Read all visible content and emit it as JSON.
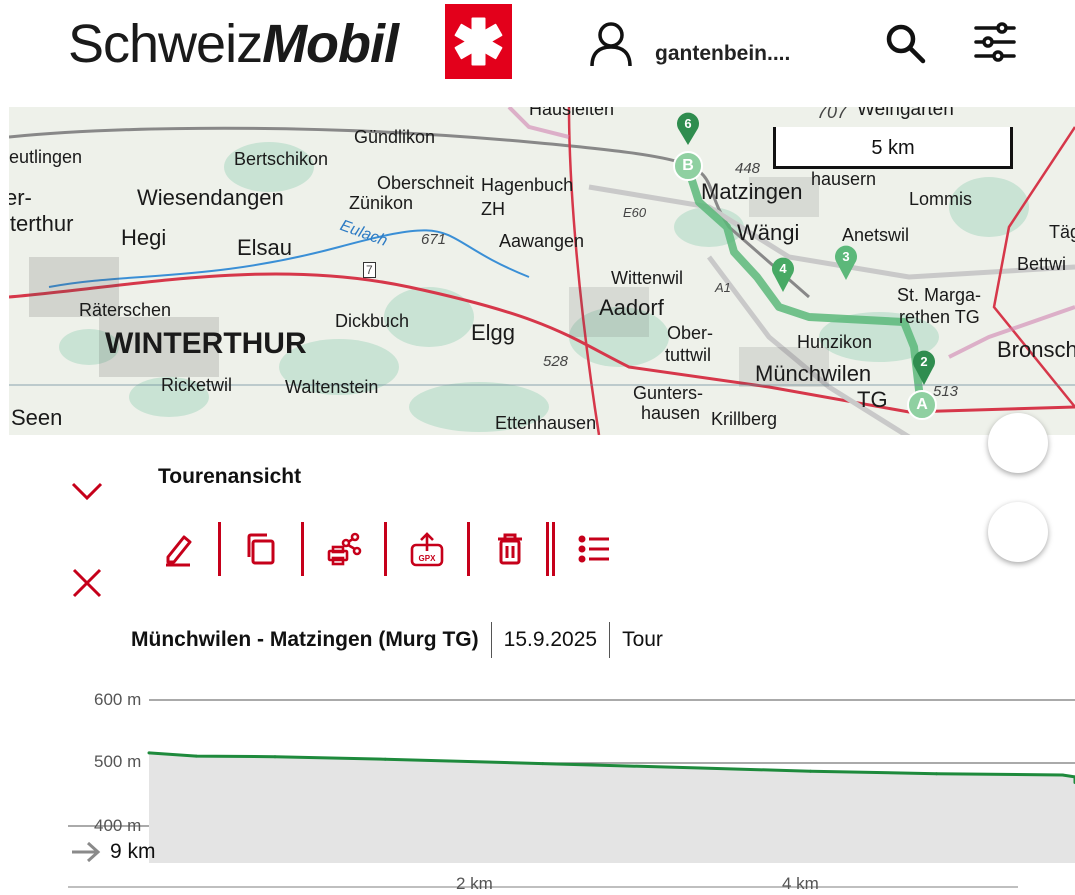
{
  "header": {
    "logo_light": "Schweiz",
    "logo_bold": "Mobil",
    "username": "gantenbein....",
    "icons": [
      "user-icon",
      "search-icon",
      "filter-icon"
    ]
  },
  "map": {
    "scale_label": "5 km",
    "places": [
      "Hausleiten",
      "Weingarten",
      "707",
      "eutlingen",
      "Gündlikon",
      "Bertschikon",
      "448",
      "Matzingen",
      "hausern",
      "Lommis",
      "er-",
      "Wiesendangen",
      "Oberschneit",
      "Hagenbuch",
      "Zünikon",
      "ZH",
      "E60",
      "Wängi",
      "Anetswil",
      "Täg",
      "iterthur",
      "Hegi",
      "Elsau",
      "Eulach",
      "671",
      "Aawangen",
      "Bettwi",
      "Wittenwil",
      "A1",
      "St. Marga-",
      "rethen TG",
      "Räterschen",
      "Dickbuch",
      "Aadorf",
      "Ober-",
      "tuttwil",
      "Hunzikon",
      "Bronsch",
      "WINTERTHUR",
      "Elgg",
      "528",
      "Münchwilen",
      "Ricketwil",
      "Waltenstein",
      "Gunters-",
      "hausen",
      "TG",
      "513",
      "Seen",
      "Ettenhausen",
      "Krillberg",
      "7"
    ],
    "waypoints": {
      "start": "A",
      "end": "B"
    },
    "pins": [
      "6",
      "4",
      "3",
      "2"
    ],
    "route_color": "#5cb87a"
  },
  "panel": {
    "title": "Tourenansicht",
    "toolbar": [
      "edit-icon",
      "copy-icon",
      "print-share-icon",
      "gpx-export-icon",
      "delete-icon",
      "list-icon"
    ],
    "gpx_label": "GPX",
    "tour_name": "Münchwilen - Matzingen (Murg TG)",
    "tour_date": "15.9.2025",
    "tour_type": "Tour",
    "distance": "9 km"
  },
  "accent_color": "#c6001a",
  "chart_data": {
    "type": "area",
    "title": "",
    "xlabel": "",
    "ylabel": "",
    "y_ticks": [
      "600 m",
      "500 m",
      "400 m"
    ],
    "x_ticks": [
      "2 km",
      "4 km"
    ],
    "ylim": [
      400,
      600
    ],
    "x": [
      0,
      0.3,
      0.8,
      1.5,
      2.5,
      3.5,
      4.2,
      5.0,
      5.8,
      6.5,
      7.5,
      8.5,
      9.0
    ],
    "values": [
      516,
      511,
      510,
      506,
      499,
      492,
      487,
      483,
      481,
      478,
      474,
      470,
      469
    ],
    "line_color": "#1e8a3c",
    "fill_color": "#e4e4e4",
    "grid": true
  }
}
